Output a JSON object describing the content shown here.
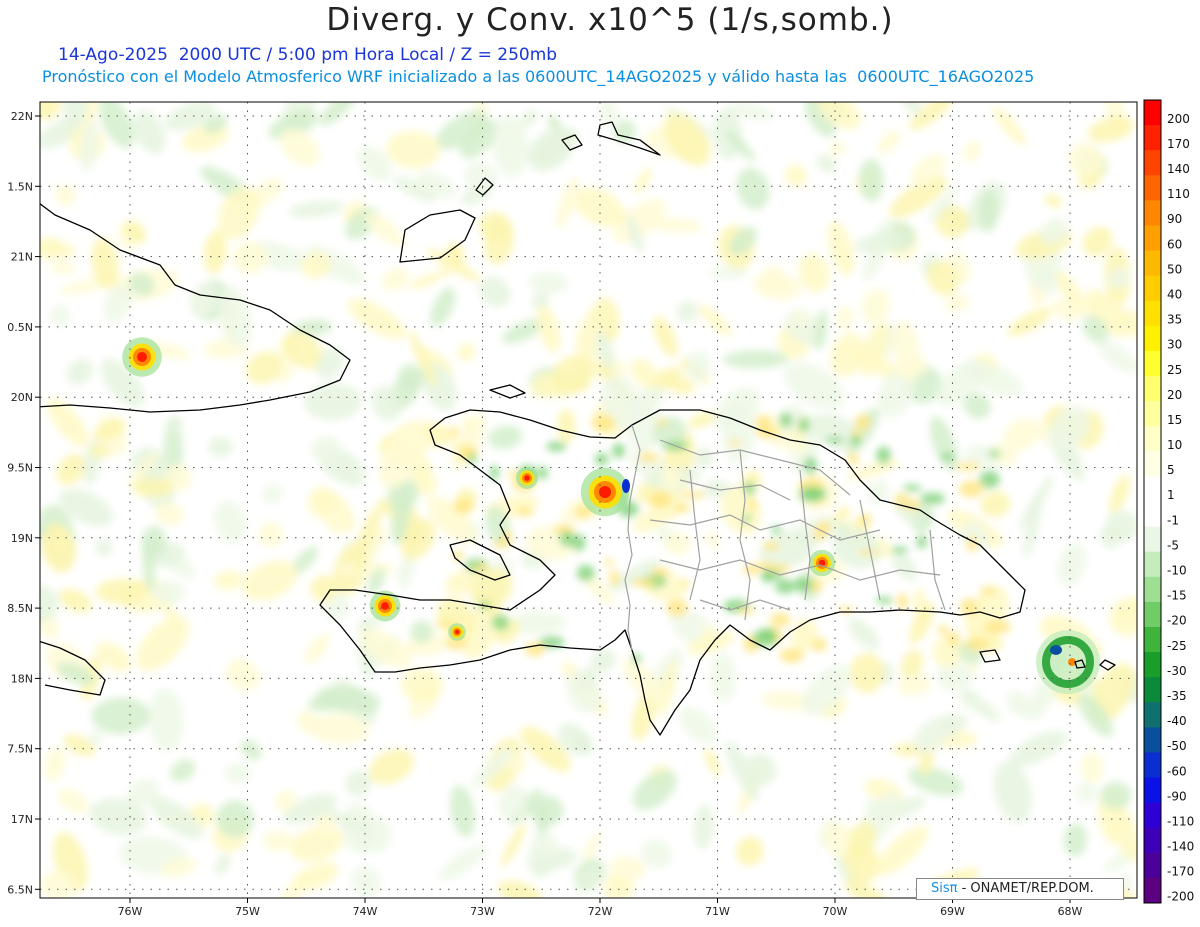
{
  "header": {
    "title": "Diverg. y Conv. x10^5 (1/s,somb.)",
    "line1": "14-Ago-2025  2000 UTC / 5:00 pm Hora Local / Z = 250mb",
    "line2": "Pronóstico con el Modelo Atmosferico WRF inicializado a las 0600UTC_14AGO2025 y válido hasta las  0600UTC_16AGO2025"
  },
  "axes": {
    "lat_labels": [
      "22N",
      "1.5N",
      "21N",
      "0.5N",
      "20N",
      "9.5N",
      "19N",
      "8.5N",
      "18N",
      "7.5N",
      "17N",
      "6.5N"
    ],
    "lon_labels": [
      "76W",
      "75W",
      "74W",
      "73W",
      "72W",
      "71W",
      "70W",
      "69W",
      "68W"
    ]
  },
  "colorbar": {
    "labels": [
      "200",
      "170",
      "140",
      "110",
      "90",
      "60",
      "50",
      "40",
      "35",
      "30",
      "25",
      "20",
      "15",
      "10",
      "5",
      "1",
      "-1",
      "-5",
      "-10",
      "-15",
      "-20",
      "-25",
      "-30",
      "-35",
      "-40",
      "-50",
      "-60",
      "-90",
      "-110",
      "-140",
      "-170",
      "-200"
    ],
    "colors": [
      "#ff0000",
      "#ff2200",
      "#ff4400",
      "#ff6600",
      "#ff8800",
      "#ffa000",
      "#ffb800",
      "#ffcc00",
      "#ffe000",
      "#fff000",
      "#ffff30",
      "#ffff70",
      "#ffffa0",
      "#ffffc8",
      "#ffffe6",
      "#ffffff",
      "#ffffff",
      "#eaf7e6",
      "#c6ecbd",
      "#9edf92",
      "#70cc66",
      "#3fb43c",
      "#1a9e2a",
      "#0a8a3a",
      "#107070",
      "#0a4f9e",
      "#0a2ecf",
      "#0a12e6",
      "#2e00d6",
      "#3d00b8",
      "#4a0099",
      "#5a0080"
    ]
  },
  "credit": {
    "brand": "Sisπ",
    "org": "- ONAMET/REP.DOM."
  },
  "colors": {
    "coast": "#000000",
    "provinces": "#a0a0a0",
    "grid": "#444444"
  }
}
